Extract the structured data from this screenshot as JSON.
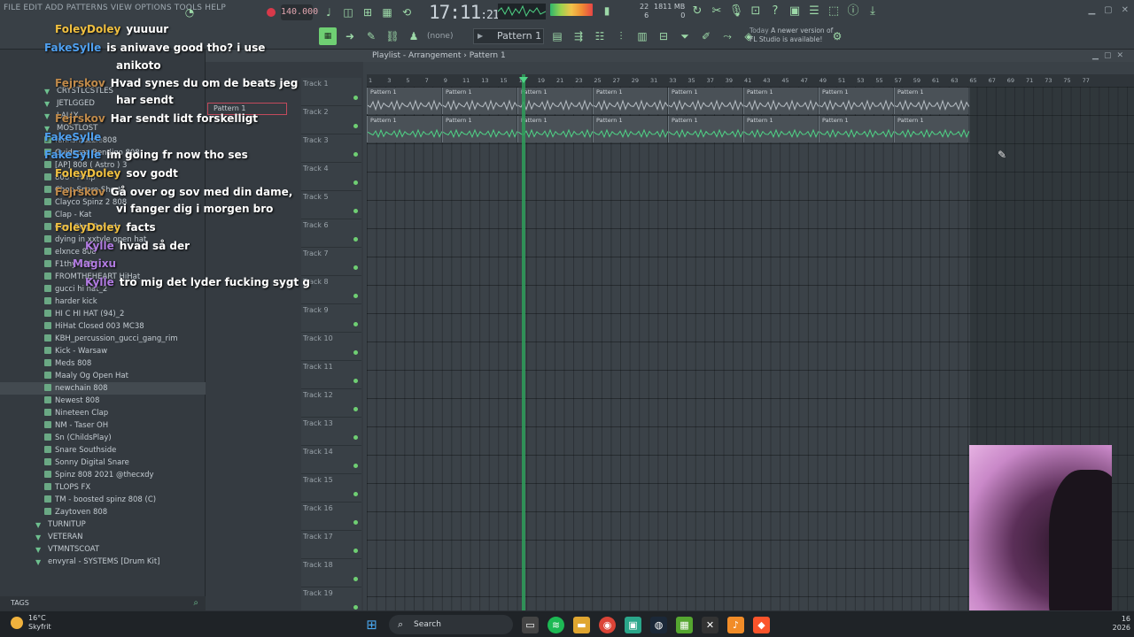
{
  "menu": "FILE  EDIT  ADD  PATTERNS  VIEW  OPTIONS  TOOLS  HELP",
  "toolbar": {
    "bpm": "140.000",
    "time": "17:11",
    "time_ticks": "21",
    "cpu": [
      "22",
      "6"
    ],
    "memory": [
      "1811 MB",
      "0"
    ],
    "snap": "(none)",
    "pattern": "Pattern 1",
    "news": [
      "Today",
      "A newer version of",
      "FL Studio is available!"
    ]
  },
  "playlist": {
    "title": "Playlist - Arrangement",
    "breadcrumb": "Pattern 1",
    "mini_pattern": "Pattern 1",
    "ruler": [
      1,
      3,
      5,
      7,
      9,
      11,
      13,
      15,
      17,
      19,
      21,
      23,
      25,
      27,
      29,
      31,
      33,
      35,
      37,
      39,
      41,
      43,
      45,
      47,
      49,
      51,
      53,
      55,
      57,
      59,
      61,
      63,
      65,
      67,
      69,
      71,
      73,
      75,
      77
    ],
    "tracks": [
      "Track 1",
      "Track 2",
      "Track 3",
      "Track 4",
      "Track 5",
      "Track 6",
      "Track 7",
      "Track 8",
      "Track 9",
      "Track 10",
      "Track 11",
      "Track 12",
      "Track 13",
      "Track 14",
      "Track 15",
      "Track 16",
      "Track 17",
      "Track 18",
      "Track 19"
    ],
    "clip_label": "Pattern 1",
    "clip_count": 8
  },
  "browser": {
    "items": [
      {
        "label": "CRYSTLCSTLES",
        "type": "folder"
      },
      {
        "label": "JETLGGED",
        "type": "folder"
      },
      {
        "label": "LALLY",
        "type": "folder"
      },
      {
        "label": "MOSTLOST",
        "type": "folder"
      },
      {
        "label": "funnsmuzzle808",
        "type": "file"
      },
      {
        "label": "Guidacaz Bendigo 808",
        "type": "file"
      },
      {
        "label": "[AP] 808 ( Astro ) 3",
        "type": "file"
      },
      {
        "label": "808 - Pimp",
        "type": "file"
      },
      {
        "label": "Chop Snare Short",
        "type": "file"
      },
      {
        "label": "Clayco Spinz 2 808",
        "type": "file"
      },
      {
        "label": "Clap - Kat",
        "type": "file"
      },
      {
        "label": "Cool Clap Reverb",
        "type": "file"
      },
      {
        "label": "dying in xxtyle open hat",
        "type": "file"
      },
      {
        "label": "elxnce 808",
        "type": "file"
      },
      {
        "label": "F1thy 808",
        "type": "file"
      },
      {
        "label": "FROMTHEHEART HiHat",
        "type": "file"
      },
      {
        "label": "gucci hi hat_2",
        "type": "file"
      },
      {
        "label": "harder kick",
        "type": "file"
      },
      {
        "label": "HI C HI HAT (94)_2",
        "type": "file"
      },
      {
        "label": "HiHat Closed 003 MC38",
        "type": "file"
      },
      {
        "label": "KBH_percussion_gucci_gang_rim",
        "type": "file"
      },
      {
        "label": "Kick - Warsaw",
        "type": "file"
      },
      {
        "label": "Meds 808",
        "type": "file"
      },
      {
        "label": "Maaly Og Open Hat",
        "type": "file"
      },
      {
        "label": "newchain 808",
        "type": "file",
        "selected": true
      },
      {
        "label": "Newest 808",
        "type": "file"
      },
      {
        "label": "Nineteen Clap",
        "type": "file"
      },
      {
        "label": "NM - Taser OH",
        "type": "file"
      },
      {
        "label": "Sn (ChildsPlay)",
        "type": "file"
      },
      {
        "label": "Snare Southside",
        "type": "file"
      },
      {
        "label": "Sonny Digital  Snare",
        "type": "file"
      },
      {
        "label": "Spinz 808 2021 @thecxdy",
        "type": "file"
      },
      {
        "label": "TLOPS FX",
        "type": "file"
      },
      {
        "label": "TM - boosted spinz 808 (C)",
        "type": "file"
      },
      {
        "label": "Zaytoven 808",
        "type": "file"
      },
      {
        "label": "TURNITUP",
        "type": "folder"
      },
      {
        "label": "VETERAN",
        "type": "folder"
      },
      {
        "label": "VTMNTSCOAT",
        "type": "folder"
      },
      {
        "label": "envyral - SYSTEMS [Drum Kit]",
        "type": "folder"
      }
    ],
    "tags": "TAGS"
  },
  "chat": [
    {
      "user": "FoleyDoley",
      "color": "#f0c040",
      "text": "yuuuur"
    },
    {
      "user": "FakeSylle",
      "color": "#4fa0f0",
      "text": "is aniwave good tho? i use"
    },
    {
      "user": "",
      "color": "#ffffff",
      "text": "anikoto"
    },
    {
      "user": "Fejrskov",
      "color": "#c08a4a",
      "text": "Hvad synes du om de beats jeg"
    },
    {
      "user": "",
      "color": "#ffffff",
      "text": "har sendt"
    },
    {
      "user": "Fejrskov",
      "color": "#c08a4a",
      "text": "Har sendt lidt forskelligt"
    },
    {
      "user": "FakeSylle",
      "color": "#4fa0f0",
      "text": ""
    },
    {
      "user": "FakeSylle",
      "color": "#4fa0f0",
      "text": "im going fr now tho ses"
    },
    {
      "user": "FoleyDoley",
      "color": "#f0c040",
      "text": "sov godt"
    },
    {
      "user": "Fejrskov",
      "color": "#c08a4a",
      "text": "Gå over og sov med din dame,"
    },
    {
      "user": "",
      "color": "#ffffff",
      "text": "vi fanger dig i morgen bro"
    },
    {
      "user": "FoleyDoley",
      "color": "#f0c040",
      "text": "facts"
    },
    {
      "user": "Kylle",
      "color": "#b07ae0",
      "text": "hvad så der"
    },
    {
      "user": "Magixu",
      "color": "#b07ae0",
      "text": ""
    },
    {
      "user": "Kylle",
      "color": "#b07ae0",
      "text": "tro mig det lyder fucking sygt g"
    }
  ],
  "taskbar": {
    "weather_temp": "16°C",
    "weather_desc": "Skyfrit",
    "search": "Search",
    "clock": [
      "16",
      "2026"
    ]
  },
  "colors": {
    "accent": "#6fcf73",
    "playhead": "#2f9e5a",
    "record": "#d8394a"
  }
}
